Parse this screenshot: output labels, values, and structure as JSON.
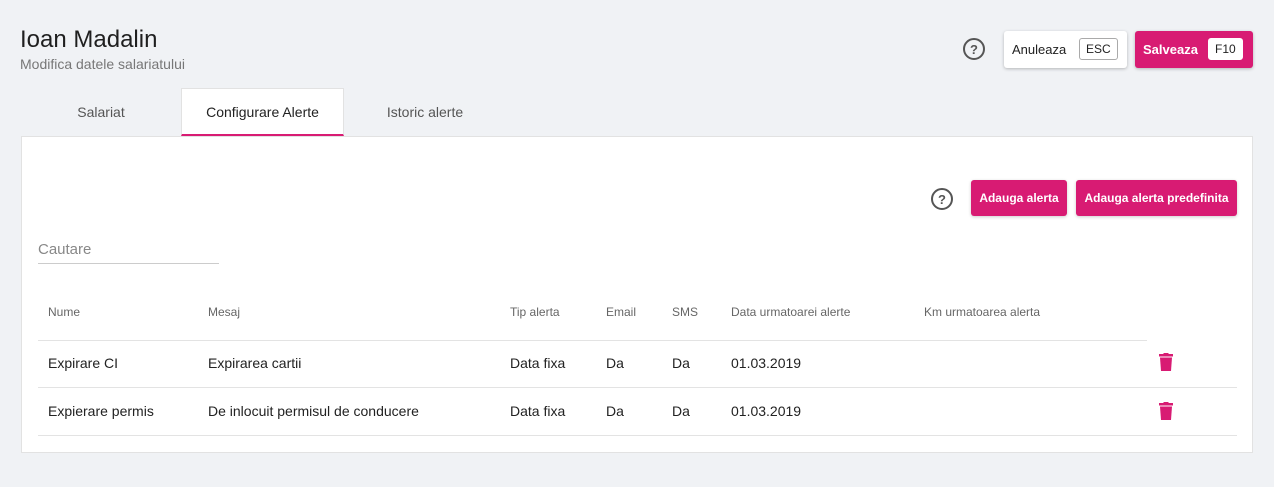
{
  "header": {
    "title": "Ioan Madalin",
    "subtitle": "Modifica datele salariatului",
    "help_label": "?",
    "cancel_label": "Anuleaza",
    "cancel_key": "ESC",
    "save_label": "Salveaza",
    "save_key": "F10"
  },
  "tabs": [
    {
      "label": "Salariat"
    },
    {
      "label": "Configurare Alerte"
    },
    {
      "label": "Istoric alerte"
    }
  ],
  "active_tab": "Configurare Alerte",
  "toolbar": {
    "help_label": "?",
    "add_label": "Adauga alerta",
    "add_predefined_label": "Adauga alerta predefinita"
  },
  "search": {
    "placeholder": "Cautare",
    "value": ""
  },
  "table": {
    "columns": [
      "Nume",
      "Mesaj",
      "Tip alerta",
      "Email",
      "SMS",
      "Data urmatoarei alerte",
      "Km urmatoarea alerta"
    ],
    "rows": [
      [
        "Expirare CI",
        "Expirarea cartii",
        "Data fixa",
        "Da",
        "Da",
        "01.03.2019",
        ""
      ],
      [
        "Expierare permis",
        "De inlocuit permisul de conducere",
        "Data fixa",
        "Da",
        "Da",
        "01.03.2019",
        ""
      ]
    ]
  },
  "colors": {
    "accent": "#d81b73",
    "background": "#f0f2f5"
  },
  "icons": {
    "help": "help-circle-icon",
    "delete": "trash-icon"
  }
}
